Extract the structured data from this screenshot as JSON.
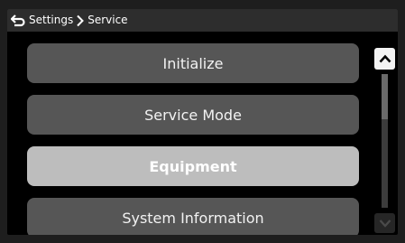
{
  "header": {
    "back_icon": "return-arrow-icon",
    "breadcrumb": [
      "Settings",
      "Service"
    ],
    "separator_icon": "chevron-right-icon"
  },
  "menu": {
    "items": [
      {
        "label": "Initialize",
        "selected": false
      },
      {
        "label": "Service Mode",
        "selected": false
      },
      {
        "label": "Equipment",
        "selected": true
      },
      {
        "label": "System Information",
        "selected": false
      }
    ]
  },
  "scrollbar": {
    "up_icon": "chevron-up-icon",
    "down_icon": "chevron-down-icon",
    "up_enabled": true,
    "down_enabled": false
  },
  "colors": {
    "header_bg": "#2d2d2d",
    "button_bg": "#565656",
    "button_selected_bg": "#bdbdbd",
    "screen_bg": "#000000"
  }
}
